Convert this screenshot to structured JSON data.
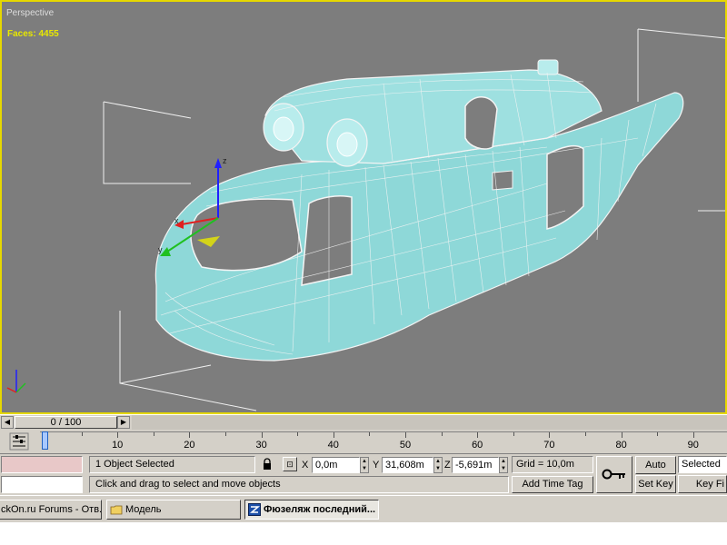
{
  "viewport": {
    "label": "Perspective",
    "faces": "Faces: 4455",
    "border_color": "#e6d800",
    "background": "#7d7d7d",
    "mesh_color": "#8ed8d8"
  },
  "time_slider": {
    "position": "0 / 100",
    "prev_icon": "arrow-left-icon",
    "next_icon": "arrow-right-icon"
  },
  "track_bar": {
    "ticks": [
      "0",
      "10",
      "20",
      "30",
      "40",
      "50",
      "60",
      "70",
      "80",
      "90"
    ],
    "current_frame": 0
  },
  "status": {
    "selection": "1 Object Selected",
    "prompt": "Click and drag to select and move objects",
    "lock_icon": "lock-icon",
    "x_label": "X",
    "x_value": "0,0m",
    "y_label": "Y",
    "y_value": "31,608m",
    "z_label": "Z",
    "z_value": "-5,691m",
    "grid": "Grid = 10,0m",
    "add_time_tag": "Add Time Tag",
    "auto_key": "Auto Key",
    "set_key": "Set Key",
    "selected_dropdown": "Selected",
    "key_filters": "Key Fi"
  },
  "taskbar": {
    "items": [
      {
        "label": "ckOn.ru Forums - Отв...",
        "icon": "browser-icon"
      },
      {
        "label": "Модель",
        "icon": "folder-icon"
      },
      {
        "label": "Фюзеляж последний...",
        "icon": "3dsmax-icon"
      }
    ]
  }
}
